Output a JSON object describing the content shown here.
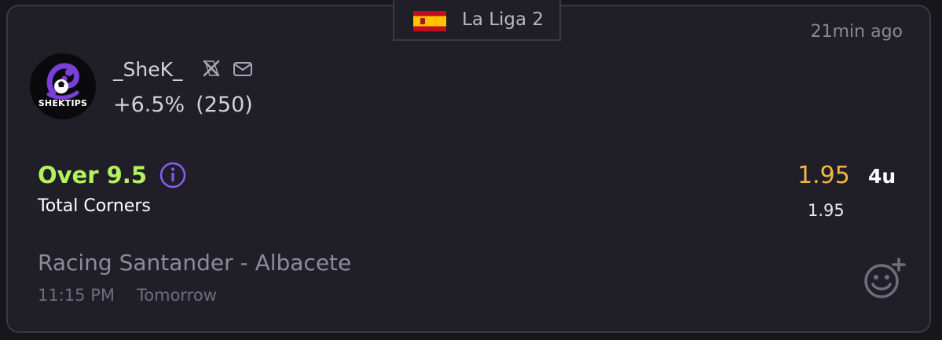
{
  "league": {
    "name": "La Liga 2",
    "flag_icon": "spain-flag-icon"
  },
  "time_ago": "21min ago",
  "tipster": {
    "avatar_text": "SHEKTIPS",
    "username": "_SheK_",
    "roi": "+6.5%",
    "tip_count": "(250)",
    "social_icons": [
      "x-icon",
      "mail-icon"
    ]
  },
  "pick": {
    "selection": "Over 9.5",
    "market": "Total Corners",
    "odds": "1.95",
    "odds_secondary": "1.95",
    "stake": "4u"
  },
  "event": {
    "teams": "Racing Santander - Albacete",
    "time": "11:15 PM",
    "day": "Tomorrow"
  },
  "colors": {
    "background": "#17161c",
    "card": "#201f27",
    "selection_green": "#b4f25c",
    "odds_orange": "#f5b544",
    "info_purple": "#8a5cf5"
  }
}
